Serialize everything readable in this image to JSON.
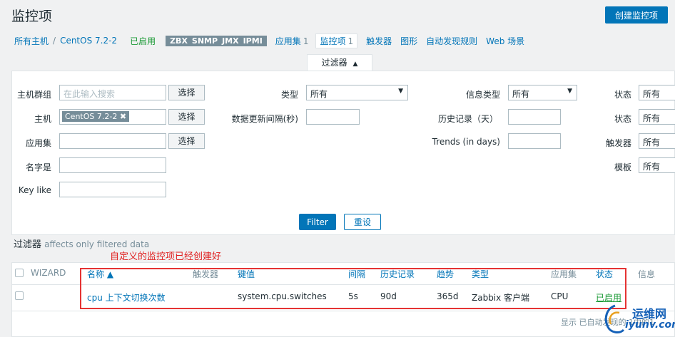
{
  "page": {
    "title": "监控项",
    "create_button": "创建监控项"
  },
  "nav": {
    "all_hosts": "所有主机",
    "separator": "/",
    "host": "CentOS 7.2-2",
    "status": "已启用",
    "tags": [
      "ZBX",
      "SNMP",
      "JMX",
      "IPMI"
    ],
    "tabs": [
      {
        "label": "应用集",
        "count": "1"
      },
      {
        "label": "监控项",
        "count": "1"
      },
      {
        "label": "触发器",
        "count": ""
      },
      {
        "label": "图形",
        "count": ""
      },
      {
        "label": "自动发现规则",
        "count": ""
      },
      {
        "label": "Web 场景",
        "count": ""
      }
    ]
  },
  "filter": {
    "tab_label": "过滤器",
    "host_group_label": "主机群组",
    "host_group_placeholder": "在此输入搜索",
    "select_label": "选择",
    "host_label": "主机",
    "host_chip": "CentOS 7.2-2",
    "app_label": "应用集",
    "name_label": "名字是",
    "key_label": "Key like",
    "type_label": "类型",
    "type_value": "所有",
    "interval_label": "数据更新间隔(秒)",
    "info_type_label": "信息类型",
    "info_type_value": "所有",
    "history_label": "历史记录（天）",
    "trends_label": "Trends (in days)",
    "state_label": "状态",
    "state_value": "所有",
    "status_label": "状态",
    "status_value": "所有",
    "triggers_label": "触发器",
    "triggers_value": "所有",
    "template_label": "模板",
    "template_value": "所有",
    "filter_button": "Filter",
    "reset_button": "重设",
    "note_title": "过滤器",
    "note_sub": "affects only filtered data"
  },
  "annotation": "自定义的监控项已经创建好",
  "table": {
    "headers": {
      "wizard": "WIZARD",
      "name": "名称 ▲",
      "triggers": "触发器",
      "key": "键值",
      "interval": "间隔",
      "history": "历史记录",
      "trends": "趋势",
      "type": "类型",
      "applications": "应用集",
      "status": "状态",
      "info": "信息"
    },
    "rows": [
      {
        "name": "cpu 上下文切换次数",
        "key": "system.cpu.switches",
        "interval": "5s",
        "history": "90d",
        "trends": "365d",
        "type": "Zabbix 客户端",
        "applications": "CPU",
        "status": "已启用"
      }
    ],
    "footer": "显示 已自动发现的 1中的1"
  },
  "watermark": {
    "line1": "运维网",
    "line2": "iyunv.com"
  },
  "colors": {
    "accent": "#0275b8",
    "enabled": "#1b9a36",
    "annotation": "#e01e1e"
  }
}
